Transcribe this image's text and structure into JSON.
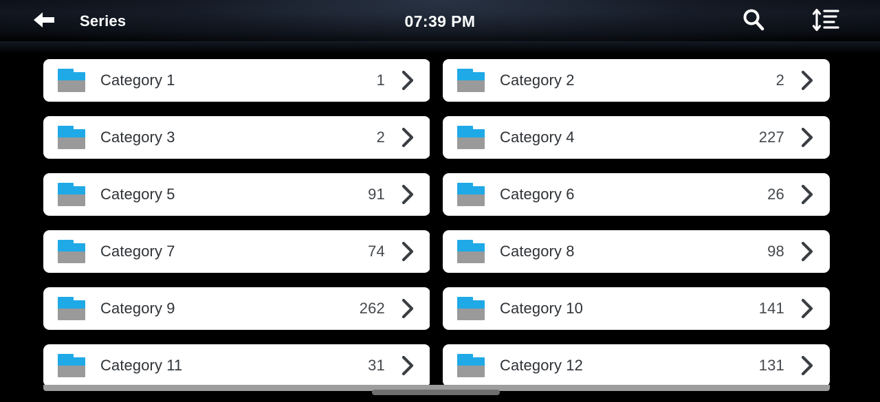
{
  "header": {
    "back_icon": "arrow-left-icon",
    "title": "Series",
    "clock": "07:39 PM",
    "search_icon": "search-icon",
    "sort_icon": "sort-by-size-icon"
  },
  "list": {
    "chevron_icon": "chevron-right-icon",
    "folder_icon": "folder-icon",
    "rows": [
      {
        "label": "Category 1",
        "count": "1"
      },
      {
        "label": "Category 2",
        "count": "2"
      },
      {
        "label": "Category 3",
        "count": "2"
      },
      {
        "label": "Category 4",
        "count": "227"
      },
      {
        "label": "Category 5",
        "count": "91"
      },
      {
        "label": "Category 6",
        "count": "26"
      },
      {
        "label": "Category 7",
        "count": "74"
      },
      {
        "label": "Category 8",
        "count": "98"
      },
      {
        "label": "Category 9",
        "count": "262"
      },
      {
        "label": "Category 10",
        "count": "141"
      },
      {
        "label": "Category 11",
        "count": "31"
      },
      {
        "label": "Category 12",
        "count": "131"
      }
    ]
  },
  "colors": {
    "folder_tab": "#1fa9e6",
    "folder_body": "#9a9a9a",
    "card_bg": "#ffffff",
    "page_bg": "#000000",
    "text": "#2f3337",
    "scroll_thumb": "#6f6f6f"
  }
}
